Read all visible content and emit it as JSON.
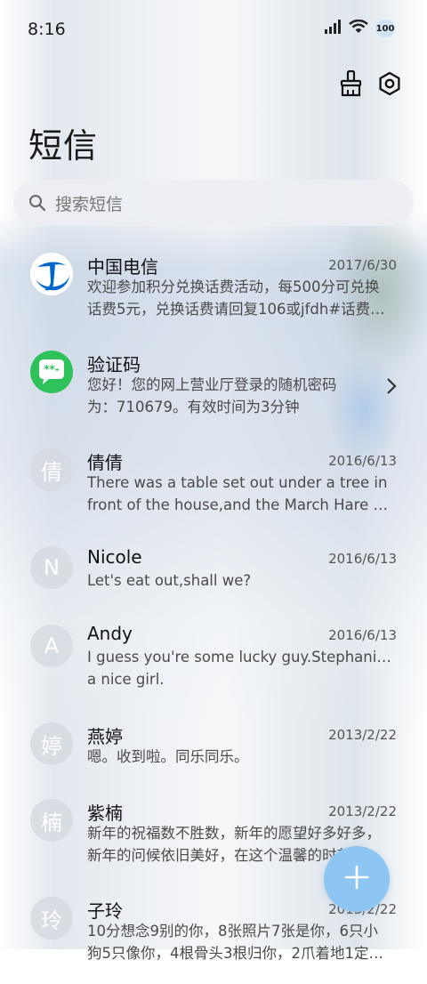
{
  "status_bar": {
    "time": "8:16",
    "battery": "100"
  },
  "header": {
    "title": "短信",
    "clean_icon": "broom-icon",
    "settings_icon": "gear-icon"
  },
  "search": {
    "placeholder": "搜索短信"
  },
  "messages": [
    {
      "name": "中国电信",
      "date": "2017/6/30",
      "preview": [
        "欢迎参加积分兑换话费活动，每500分可兑换",
        "话费5元，兑换话费请回复106或jfdh#话费…"
      ],
      "avatar_type": "logo",
      "avatar_icon": "china-telecom-logo"
    },
    {
      "name": "验证码",
      "date": "",
      "preview": [
        "您好！您的网上营业厅登录的随机密码",
        "为：710679。有效时间为3分钟"
      ],
      "avatar_type": "icon",
      "avatar_icon": "message-bubble-icon"
    },
    {
      "name": "倩倩",
      "date": "2016/6/13",
      "preview": [
        "There was a table set out under a tree in",
        "front of the house,and the March Hare an…"
      ],
      "avatar_type": "letter",
      "avatar_char": "倩"
    },
    {
      "name": "Nicole",
      "date": "2016/6/13",
      "preview": [
        "Let's eat out,shall we?"
      ],
      "avatar_type": "letter",
      "avatar_char": "N"
    },
    {
      "name": "Andy",
      "date": "2016/6/13",
      "preview": [
        "I guess you're some lucky guy.Stephanie is",
        "a nice girl."
      ],
      "avatar_type": "letter",
      "avatar_char": "A"
    },
    {
      "name": "燕婷",
      "date": "2013/2/22",
      "preview": [
        "嗯。收到啦。同乐同乐。"
      ],
      "avatar_type": "letter",
      "avatar_char": "婷"
    },
    {
      "name": "紫楠",
      "date": "2013/2/22",
      "preview": [
        "新年的祝福数不胜数，新年的愿望好多好多，",
        "新年的问候依旧美好，在这个温馨的时刻…"
      ],
      "avatar_type": "letter",
      "avatar_char": "楠"
    },
    {
      "name": "子玲",
      "date": "2013/2/22",
      "preview": [
        "10分想念9别的你，8张照片7张是你，6只小",
        "狗5只像你，4根骨头3根归你，2爪着地1定…"
      ],
      "avatar_type": "letter",
      "avatar_char": "玲"
    }
  ],
  "fab": {
    "icon": "plus-icon"
  },
  "colors": {
    "fab": "#8dc6f2",
    "telecom_blue": "#0066cc",
    "bubble_green": "#2fc25b"
  }
}
